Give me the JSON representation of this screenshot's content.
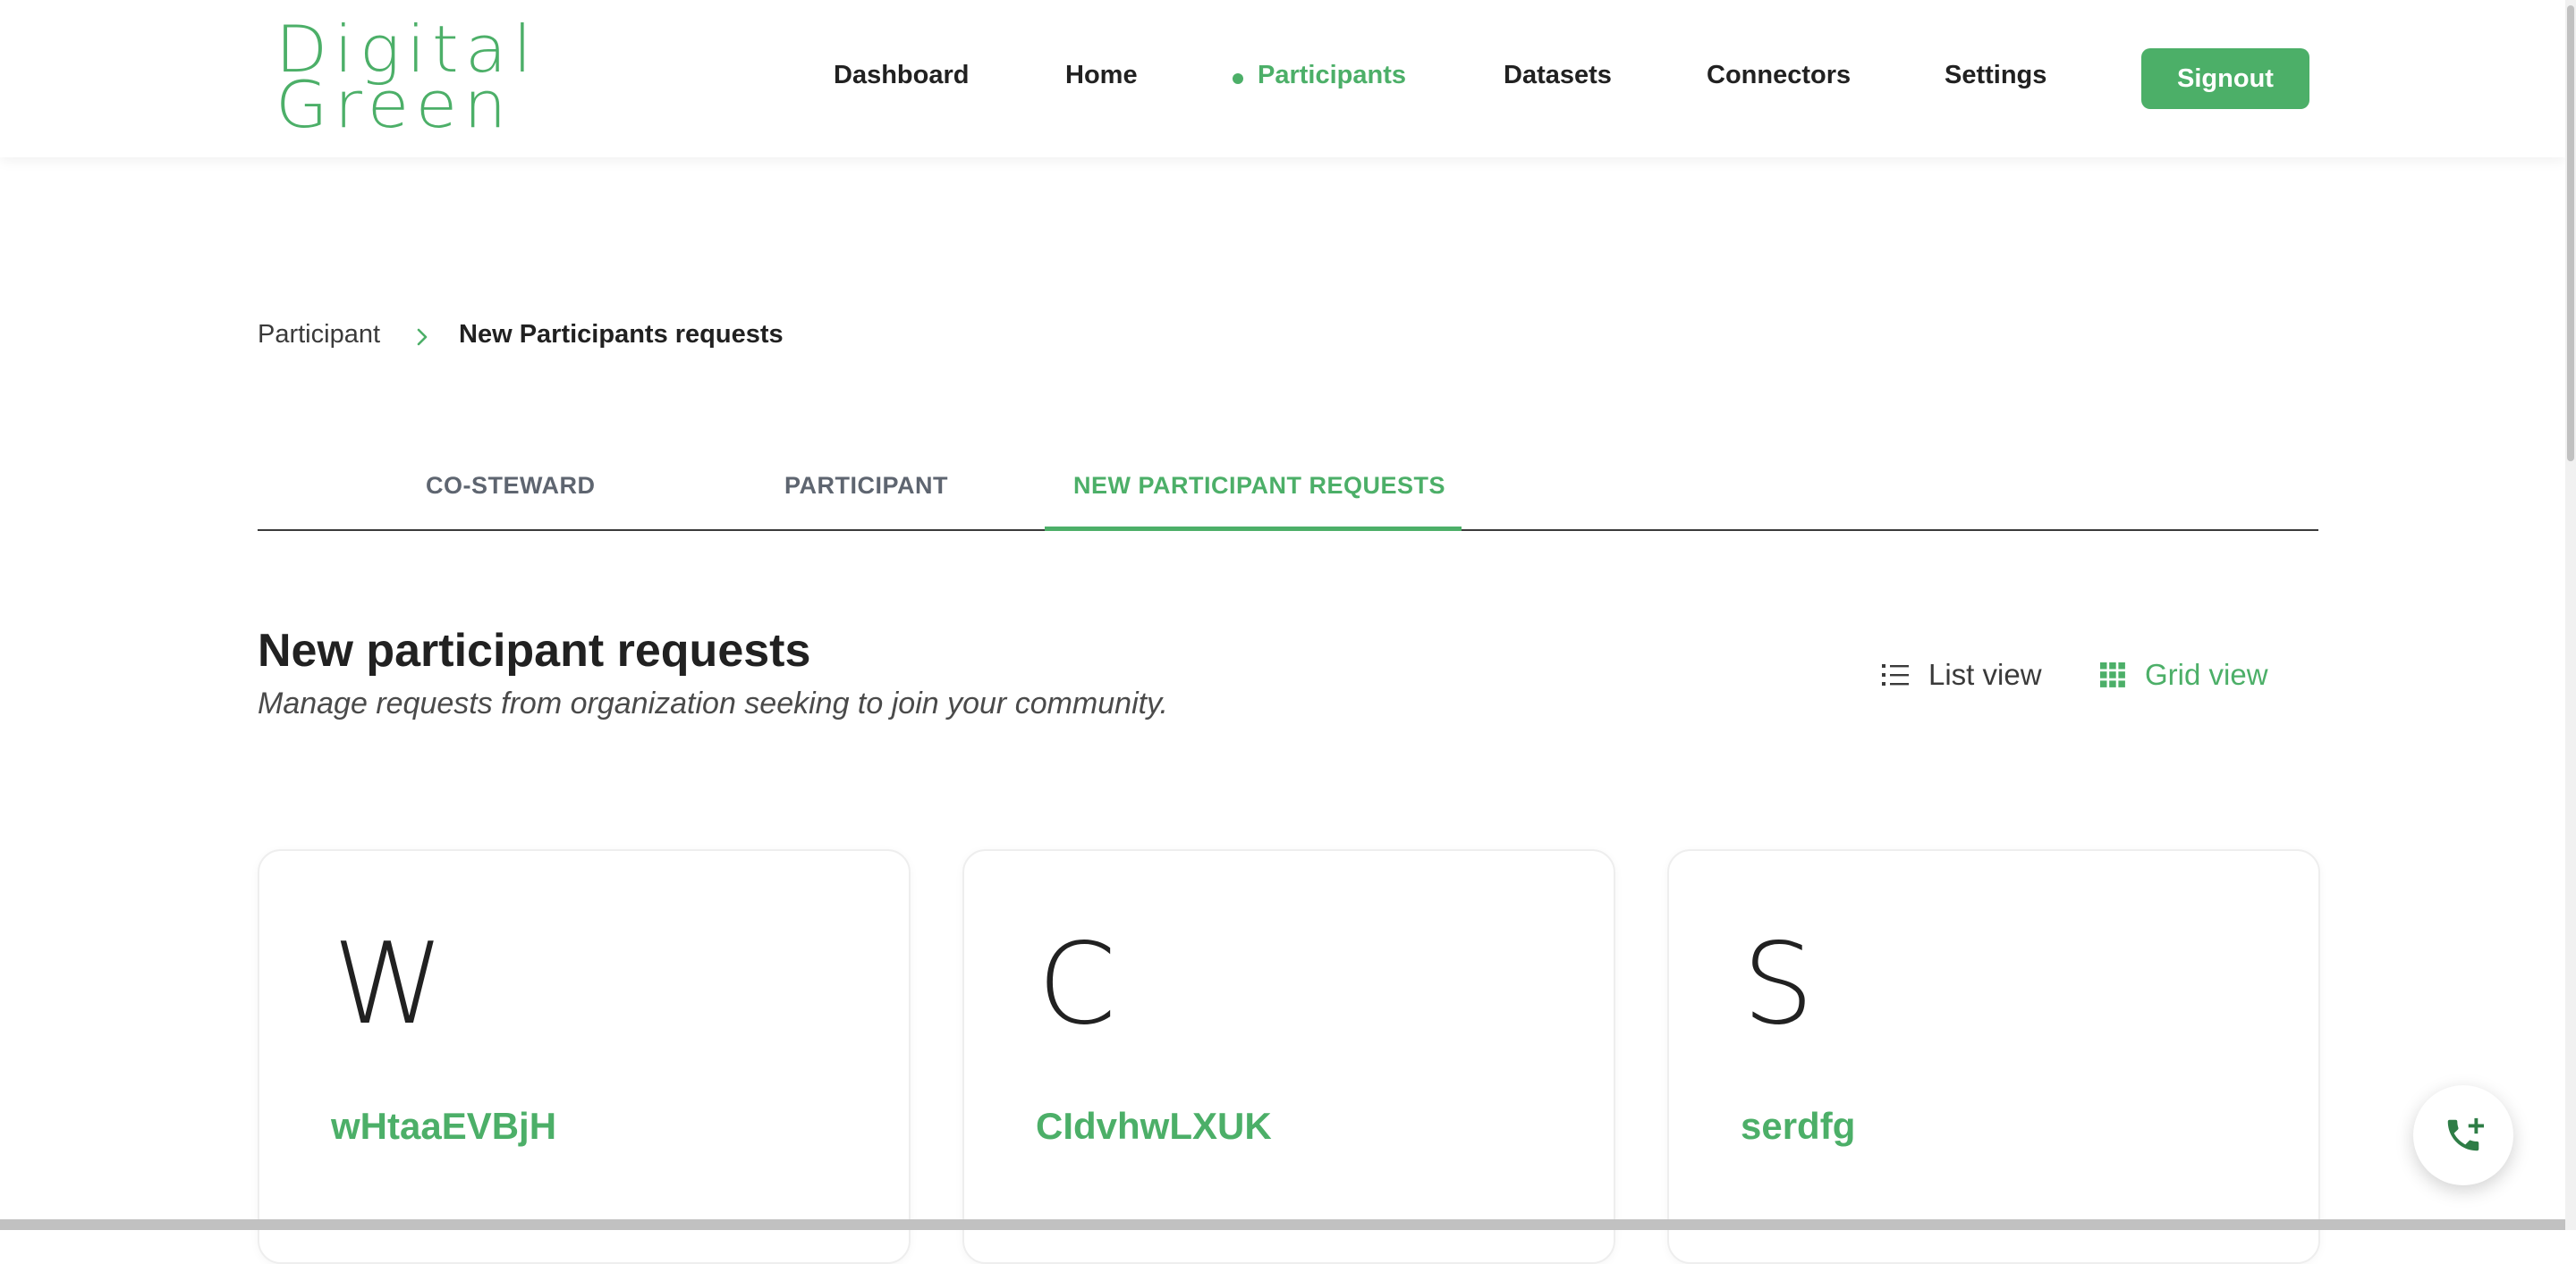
{
  "brand": {
    "line1": "Digital",
    "line2": "Green",
    "color": "#4caf68"
  },
  "nav": {
    "items": [
      {
        "label": "Dashboard",
        "active": false
      },
      {
        "label": "Home",
        "active": false
      },
      {
        "label": "Participants",
        "active": true
      },
      {
        "label": "Datasets",
        "active": false
      },
      {
        "label": "Connectors",
        "active": false
      },
      {
        "label": "Settings",
        "active": false
      }
    ],
    "signout_label": "Signout"
  },
  "breadcrumb": {
    "parent": "Participant",
    "current": "New Participants requests",
    "separator_icon": "chevron-right-icon"
  },
  "tabs": [
    {
      "label": "CO-STEWARD",
      "active": false
    },
    {
      "label": "PARTICIPANT",
      "active": false
    },
    {
      "label": "NEW PARTICIPANT REQUESTS",
      "active": true
    }
  ],
  "section": {
    "title": "New participant requests",
    "subtitle": "Manage requests from organization seeking to join your community."
  },
  "view_toggle": {
    "list_label": "List view",
    "list_icon": "list-icon",
    "grid_label": "Grid view",
    "grid_icon": "grid-icon",
    "selected": "grid"
  },
  "cards": [
    {
      "initial": "W",
      "name": "wHtaaEVBjH"
    },
    {
      "initial": "C",
      "name": "CIdvhwLXUK"
    },
    {
      "initial": "S",
      "name": "serdfg"
    }
  ],
  "fab": {
    "icon": "phone-add-icon"
  }
}
